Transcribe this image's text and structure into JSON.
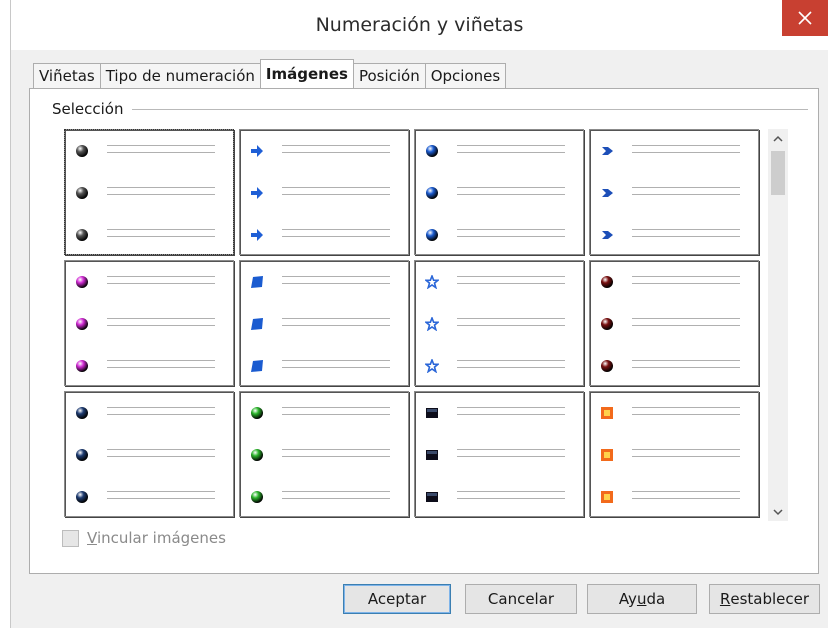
{
  "window": {
    "title": "Numeración y viñetas",
    "close_icon": "close-icon"
  },
  "tabs": [
    {
      "label": "Viñetas",
      "active": false
    },
    {
      "label": "Tipo de numeración",
      "active": false
    },
    {
      "label": "Imágenes",
      "active": true
    },
    {
      "label": "Posición",
      "active": false
    },
    {
      "label": "Opciones",
      "active": false
    }
  ],
  "selection": {
    "group_label": "Selección",
    "cells": [
      {
        "icon": "gray-sphere-bullet-icon",
        "color": "#555555",
        "selected": true
      },
      {
        "icon": "blue-arrow-bullet-icon",
        "color": "#1f5fd6",
        "selected": false
      },
      {
        "icon": "blue-sphere-bullet-icon",
        "color": "#1a5bd0",
        "selected": false
      },
      {
        "icon": "blue-diamond-arrow-bullet-icon",
        "color": "#1d4fb8",
        "selected": false
      },
      {
        "icon": "pink-sphere-bullet-icon",
        "color": "#d12ad4",
        "selected": false
      },
      {
        "icon": "blue-square-bullet-icon",
        "color": "#1a5bd0",
        "selected": false
      },
      {
        "icon": "blue-star-bullet-icon",
        "color": "#2a66d8",
        "selected": false
      },
      {
        "icon": "dark-red-sphere-bullet-icon",
        "color": "#7a1010",
        "selected": false
      },
      {
        "icon": "navy-sphere-bullet-icon",
        "color": "#1e3c72",
        "selected": false
      },
      {
        "icon": "green-sphere-bullet-icon",
        "color": "#2bb52b",
        "selected": false
      },
      {
        "icon": "black-square-bullet-icon",
        "color": "#0d0d1a",
        "selected": false
      },
      {
        "icon": "orange-square-bullet-icon",
        "color": "#f26a1b",
        "selected": false
      }
    ]
  },
  "link_images": {
    "label_prefix": "V",
    "label_rest": "incular imágenes",
    "checked": false,
    "enabled": false
  },
  "buttons": {
    "ok": "Aceptar",
    "cancel": "Cancelar",
    "help_a": "Ay",
    "help_u": "u",
    "help_b": "da",
    "reset_r": "R",
    "reset_rest": "establecer"
  }
}
